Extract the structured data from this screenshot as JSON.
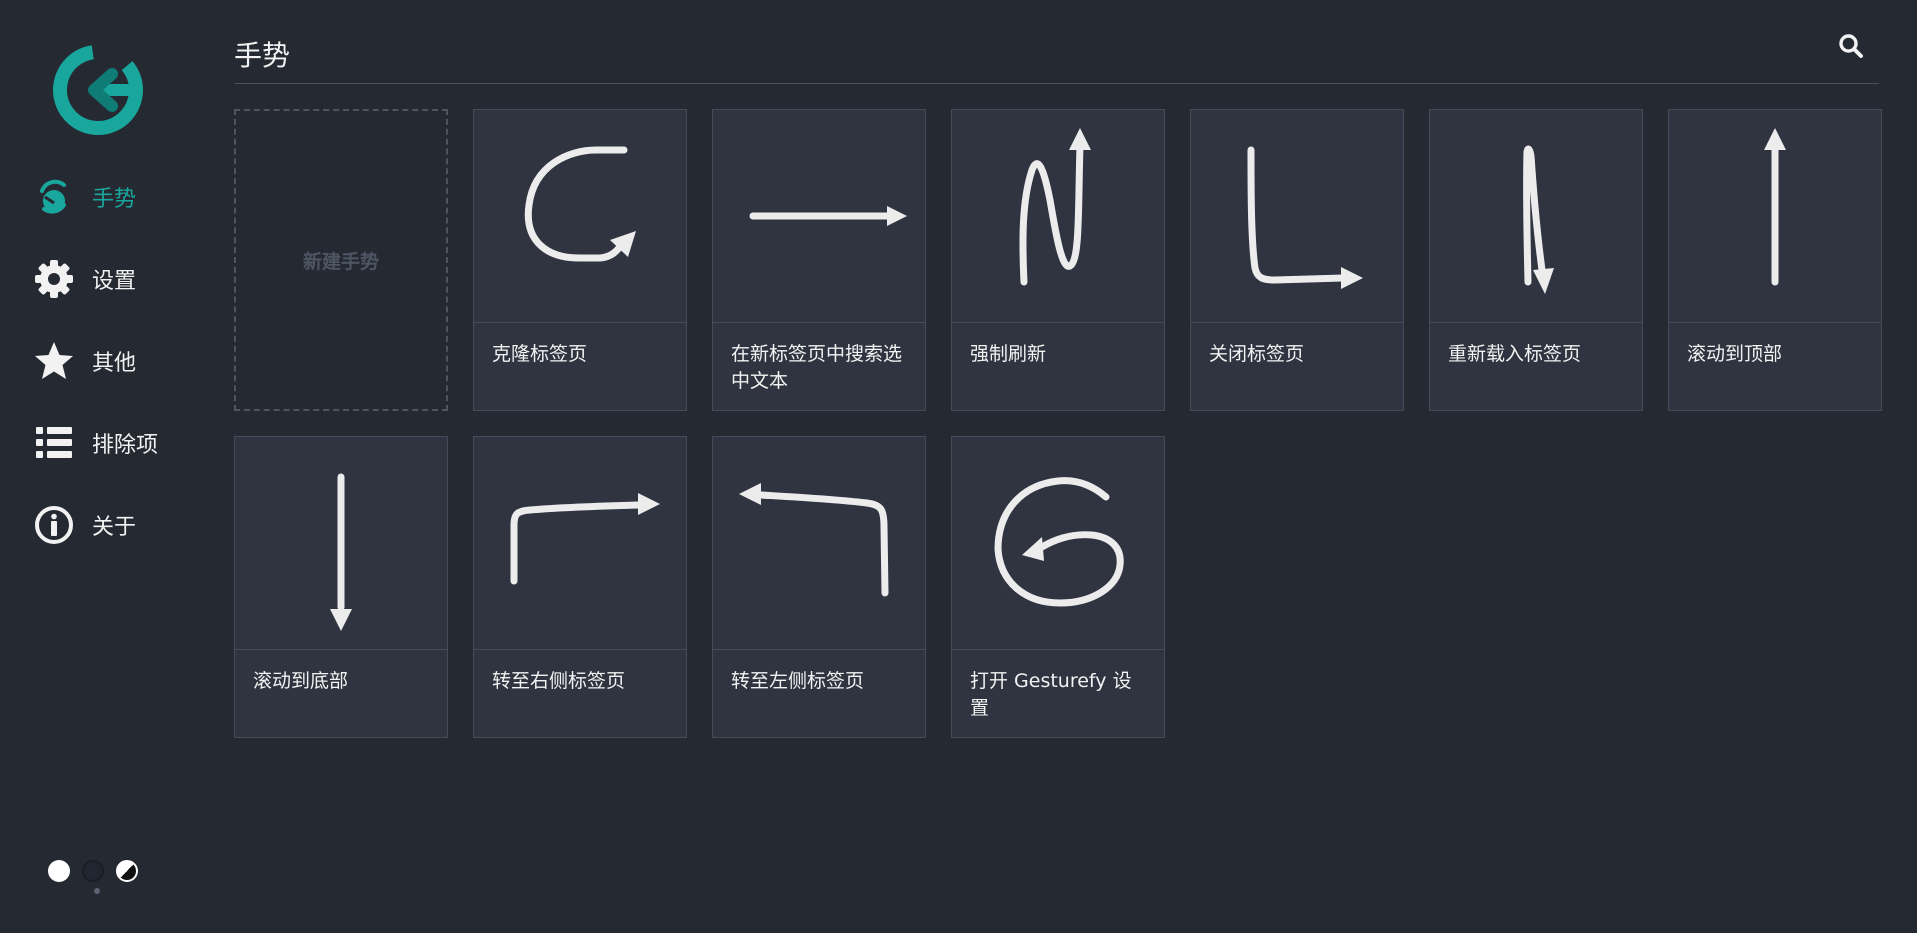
{
  "app": {
    "logo": "gesturefy-logo",
    "brand_color": "#19a79d"
  },
  "sidebar": {
    "items": [
      {
        "label": "手势",
        "icon": "gestures-icon",
        "active": true
      },
      {
        "label": "设置",
        "icon": "gear-icon",
        "active": false
      },
      {
        "label": "其他",
        "icon": "star-icon",
        "active": false
      },
      {
        "label": "排除项",
        "icon": "list-icon",
        "active": false
      },
      {
        "label": "关于",
        "icon": "info-icon",
        "active": false
      }
    ]
  },
  "theme_switch": {
    "options": [
      "light",
      "dark",
      "auto"
    ]
  },
  "header": {
    "title": "手势",
    "search_icon": "search-icon"
  },
  "gestures": {
    "new_label": "新建手势",
    "cards": [
      {
        "label": "克隆标签页",
        "glyph": "c-curve-arrow"
      },
      {
        "label": "在新标签页中搜索选中文本",
        "glyph": "right-arrow"
      },
      {
        "label": "强制刷新",
        "glyph": "n-up-arrow"
      },
      {
        "label": "关闭标签页",
        "glyph": "l-right-arrow"
      },
      {
        "label": "重新载入标签页",
        "glyph": "up-down-arrow"
      },
      {
        "label": "滚动到顶部",
        "glyph": "up-arrow"
      },
      {
        "label": "滚动到底部",
        "glyph": "down-arrow"
      },
      {
        "label": "转至右侧标签页",
        "glyph": "up-right-arrow"
      },
      {
        "label": "转至左侧标签页",
        "glyph": "up-left-arrow"
      },
      {
        "label": "打开 Gesturefy 设置",
        "glyph": "g-spiral-arrow"
      }
    ]
  },
  "colors": {
    "background": "#252932",
    "card": "#2f3440",
    "accent": "#19a79d",
    "text": "#f2f2f2"
  }
}
